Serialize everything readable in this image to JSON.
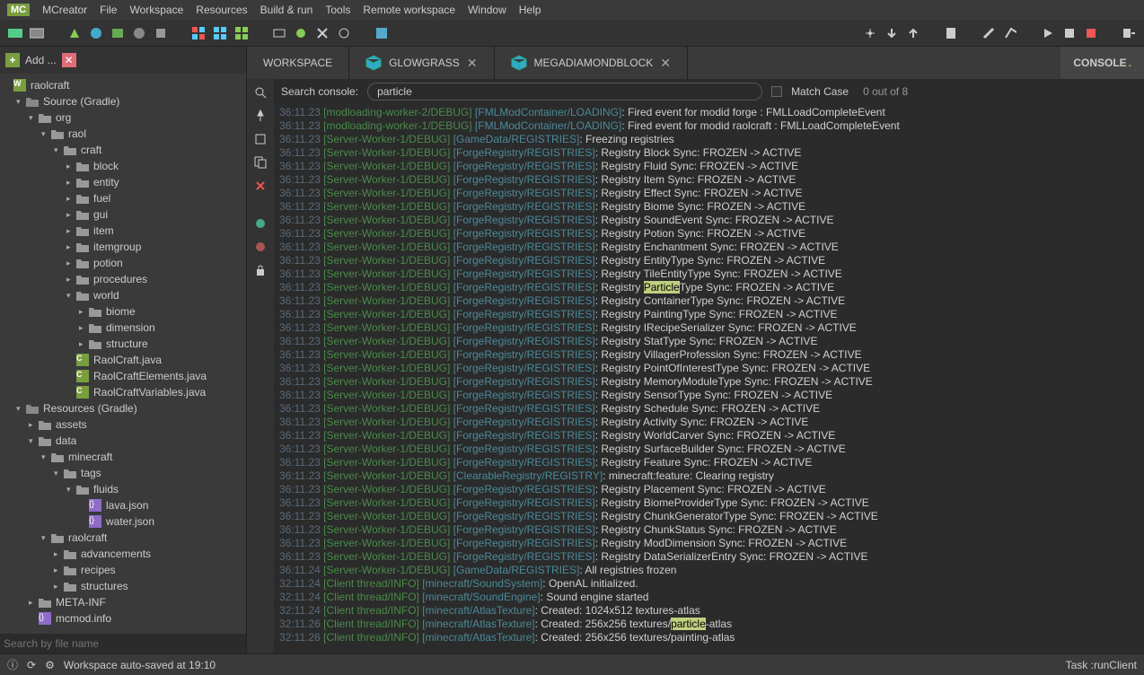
{
  "menu": [
    "MCreator",
    "File",
    "Workspace",
    "Resources",
    "Build & run",
    "Tools",
    "Remote workspace",
    "Window",
    "Help"
  ],
  "sidebar": {
    "add": "Add ...",
    "root": "raolcraft",
    "src": "Source (Gradle)",
    "org": "org",
    "raol": "raol",
    "craft": "craft",
    "folders": [
      "block",
      "entity",
      "fuel",
      "gui",
      "item",
      "itemgroup",
      "potion",
      "procedures",
      "world"
    ],
    "world_sub": [
      "biome",
      "dimension",
      "structure"
    ],
    "java": [
      "RaolCraft.java",
      "RaolCraftElements.java",
      "RaolCraftVariables.java"
    ],
    "res": "Resources (Gradle)",
    "assets": "assets",
    "data": "data",
    "minecraft": "minecraft",
    "tags": "tags",
    "fluids": "fluids",
    "json": [
      "lava.json",
      "water.json"
    ],
    "raolcraft_res": "raolcraft",
    "res_sub": [
      "advancements",
      "recipes",
      "structures"
    ],
    "metainf": "META-INF",
    "mcmod": "mcmod.info",
    "search_ph": "Search by file name"
  },
  "tabs": {
    "workspace": "WORKSPACE",
    "t1": "GLOWGRASS",
    "t2": "MEGADIAMONDBLOCK",
    "console": "CONSOLE"
  },
  "search": {
    "label": "Search console:",
    "value": "particle",
    "match": "Match Case",
    "count": "0 out of 8"
  },
  "logs": [
    {
      "ts": "36:11.23",
      "src": "[modloading-worker-2/DEBUG]",
      "tag": "[FMLModContainer/LOADING]",
      "msg": "Fired event for modid forge : FMLLoadCompleteEvent"
    },
    {
      "ts": "36:11.23",
      "src": "[modloading-worker-1/DEBUG]",
      "tag": "[FMLModContainer/LOADING]",
      "msg": "Fired event for modid raolcraft : FMLLoadCompleteEvent"
    },
    {
      "ts": "36:11.23",
      "src": "[Server-Worker-1/DEBUG]",
      "tag": "[GameData/REGISTRIES]",
      "msg": "Freezing registries"
    },
    {
      "ts": "36:11.23",
      "src": "[Server-Worker-1/DEBUG]",
      "tag": "[ForgeRegistry/REGISTRIES]",
      "msg": "Registry Block Sync: FROZEN -> ACTIVE"
    },
    {
      "ts": "36:11.23",
      "src": "[Server-Worker-1/DEBUG]",
      "tag": "[ForgeRegistry/REGISTRIES]",
      "msg": "Registry Fluid Sync: FROZEN -> ACTIVE"
    },
    {
      "ts": "36:11.23",
      "src": "[Server-Worker-1/DEBUG]",
      "tag": "[ForgeRegistry/REGISTRIES]",
      "msg": "Registry Item Sync: FROZEN -> ACTIVE"
    },
    {
      "ts": "36:11.23",
      "src": "[Server-Worker-1/DEBUG]",
      "tag": "[ForgeRegistry/REGISTRIES]",
      "msg": "Registry Effect Sync: FROZEN -> ACTIVE"
    },
    {
      "ts": "36:11.23",
      "src": "[Server-Worker-1/DEBUG]",
      "tag": "[ForgeRegistry/REGISTRIES]",
      "msg": "Registry Biome Sync: FROZEN -> ACTIVE"
    },
    {
      "ts": "36:11.23",
      "src": "[Server-Worker-1/DEBUG]",
      "tag": "[ForgeRegistry/REGISTRIES]",
      "msg": "Registry SoundEvent Sync: FROZEN -> ACTIVE"
    },
    {
      "ts": "36:11.23",
      "src": "[Server-Worker-1/DEBUG]",
      "tag": "[ForgeRegistry/REGISTRIES]",
      "msg": "Registry Potion Sync: FROZEN -> ACTIVE"
    },
    {
      "ts": "36:11.23",
      "src": "[Server-Worker-1/DEBUG]",
      "tag": "[ForgeRegistry/REGISTRIES]",
      "msg": "Registry Enchantment Sync: FROZEN -> ACTIVE"
    },
    {
      "ts": "36:11.23",
      "src": "[Server-Worker-1/DEBUG]",
      "tag": "[ForgeRegistry/REGISTRIES]",
      "msg": "Registry EntityType Sync: FROZEN -> ACTIVE"
    },
    {
      "ts": "36:11.23",
      "src": "[Server-Worker-1/DEBUG]",
      "tag": "[ForgeRegistry/REGISTRIES]",
      "msg": "Registry TileEntityType Sync: FROZEN -> ACTIVE"
    },
    {
      "ts": "36:11.23",
      "src": "[Server-Worker-1/DEBUG]",
      "tag": "[ForgeRegistry/REGISTRIES]",
      "msg": "Registry |HL|Type Sync: FROZEN -> ACTIVE",
      "hl": "Particle"
    },
    {
      "ts": "36:11.23",
      "src": "[Server-Worker-1/DEBUG]",
      "tag": "[ForgeRegistry/REGISTRIES]",
      "msg": "Registry ContainerType Sync: FROZEN -> ACTIVE"
    },
    {
      "ts": "36:11.23",
      "src": "[Server-Worker-1/DEBUG]",
      "tag": "[ForgeRegistry/REGISTRIES]",
      "msg": "Registry PaintingType Sync: FROZEN -> ACTIVE"
    },
    {
      "ts": "36:11.23",
      "src": "[Server-Worker-1/DEBUG]",
      "tag": "[ForgeRegistry/REGISTRIES]",
      "msg": "Registry IRecipeSerializer Sync: FROZEN -> ACTIVE"
    },
    {
      "ts": "36:11.23",
      "src": "[Server-Worker-1/DEBUG]",
      "tag": "[ForgeRegistry/REGISTRIES]",
      "msg": "Registry StatType Sync: FROZEN -> ACTIVE"
    },
    {
      "ts": "36:11.23",
      "src": "[Server-Worker-1/DEBUG]",
      "tag": "[ForgeRegistry/REGISTRIES]",
      "msg": "Registry VillagerProfession Sync: FROZEN -> ACTIVE"
    },
    {
      "ts": "36:11.23",
      "src": "[Server-Worker-1/DEBUG]",
      "tag": "[ForgeRegistry/REGISTRIES]",
      "msg": "Registry PointOfInterestType Sync: FROZEN -> ACTIVE"
    },
    {
      "ts": "36:11.23",
      "src": "[Server-Worker-1/DEBUG]",
      "tag": "[ForgeRegistry/REGISTRIES]",
      "msg": "Registry MemoryModuleType Sync: FROZEN -> ACTIVE"
    },
    {
      "ts": "36:11.23",
      "src": "[Server-Worker-1/DEBUG]",
      "tag": "[ForgeRegistry/REGISTRIES]",
      "msg": "Registry SensorType Sync: FROZEN -> ACTIVE"
    },
    {
      "ts": "36:11.23",
      "src": "[Server-Worker-1/DEBUG]",
      "tag": "[ForgeRegistry/REGISTRIES]",
      "msg": "Registry Schedule Sync: FROZEN -> ACTIVE"
    },
    {
      "ts": "36:11.23",
      "src": "[Server-Worker-1/DEBUG]",
      "tag": "[ForgeRegistry/REGISTRIES]",
      "msg": "Registry Activity Sync: FROZEN -> ACTIVE"
    },
    {
      "ts": "36:11.23",
      "src": "[Server-Worker-1/DEBUG]",
      "tag": "[ForgeRegistry/REGISTRIES]",
      "msg": "Registry WorldCarver Sync: FROZEN -> ACTIVE"
    },
    {
      "ts": "36:11.23",
      "src": "[Server-Worker-1/DEBUG]",
      "tag": "[ForgeRegistry/REGISTRIES]",
      "msg": "Registry SurfaceBuilder Sync: FROZEN -> ACTIVE"
    },
    {
      "ts": "36:11.23",
      "src": "[Server-Worker-1/DEBUG]",
      "tag": "[ForgeRegistry/REGISTRIES]",
      "msg": "Registry Feature Sync: FROZEN -> ACTIVE"
    },
    {
      "ts": "36:11.23",
      "src": "[Server-Worker-1/DEBUG]",
      "tag": "[ClearableRegistry/REGISTRY]",
      "msg": "minecraft:feature: Clearing registry"
    },
    {
      "ts": "36:11.23",
      "src": "[Server-Worker-1/DEBUG]",
      "tag": "[ForgeRegistry/REGISTRIES]",
      "msg": "Registry Placement Sync: FROZEN -> ACTIVE"
    },
    {
      "ts": "36:11.23",
      "src": "[Server-Worker-1/DEBUG]",
      "tag": "[ForgeRegistry/REGISTRIES]",
      "msg": "Registry BiomeProviderType Sync: FROZEN -> ACTIVE"
    },
    {
      "ts": "36:11.23",
      "src": "[Server-Worker-1/DEBUG]",
      "tag": "[ForgeRegistry/REGISTRIES]",
      "msg": "Registry ChunkGeneratorType Sync: FROZEN -> ACTIVE"
    },
    {
      "ts": "36:11.23",
      "src": "[Server-Worker-1/DEBUG]",
      "tag": "[ForgeRegistry/REGISTRIES]",
      "msg": "Registry ChunkStatus Sync: FROZEN -> ACTIVE"
    },
    {
      "ts": "36:11.23",
      "src": "[Server-Worker-1/DEBUG]",
      "tag": "[ForgeRegistry/REGISTRIES]",
      "msg": "Registry ModDimension Sync: FROZEN -> ACTIVE"
    },
    {
      "ts": "36:11.23",
      "src": "[Server-Worker-1/DEBUG]",
      "tag": "[ForgeRegistry/REGISTRIES]",
      "msg": "Registry DataSerializerEntry Sync: FROZEN -> ACTIVE"
    },
    {
      "ts": "36:11.24",
      "src": "[Server-Worker-1/DEBUG]",
      "tag": "[GameData/REGISTRIES]",
      "msg": "All registries frozen"
    },
    {
      "ts": "32:11.24",
      "src": "[Client thread/INFO]",
      "tag": "[minecraft/SoundSystem]",
      "msg": "OpenAL initialized."
    },
    {
      "ts": "32:11.24",
      "src": "[Client thread/INFO]",
      "tag": "[minecraft/SoundEngine]",
      "msg": "Sound engine started"
    },
    {
      "ts": "32:11.24",
      "src": "[Client thread/INFO]",
      "tag": "[minecraft/AtlasTexture]",
      "msg": "Created: 1024x512 textures-atlas"
    },
    {
      "ts": "32:11.26",
      "src": "[Client thread/INFO]",
      "tag": "[minecraft/AtlasTexture]",
      "msg": "Created: 256x256 textures/|HL|-atlas",
      "hl": "particle"
    },
    {
      "ts": "32:11.26",
      "src": "[Client thread/INFO]",
      "tag": "[minecraft/AtlasTexture]",
      "msg": "Created: 256x256 textures/painting-atlas"
    }
  ],
  "status": {
    "left": "Workspace auto-saved at 19:10",
    "right": "Task :runClient"
  }
}
